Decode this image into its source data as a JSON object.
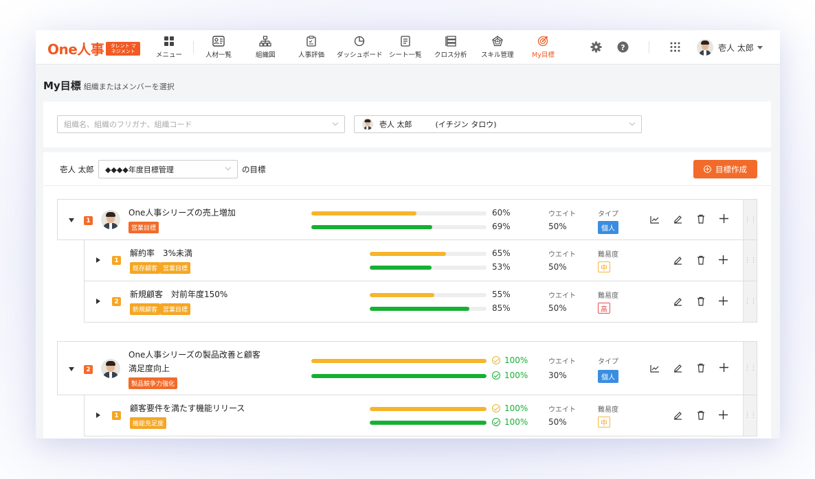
{
  "header": {
    "logo": "One人事",
    "logo_badge": "タレント マネジメント",
    "nav": [
      {
        "label": "メニュー",
        "icon": "grid-menu-icon"
      },
      {
        "label": "人材一覧",
        "icon": "person-card-icon"
      },
      {
        "label": "組織図",
        "icon": "org-chart-icon"
      },
      {
        "label": "人事評価",
        "icon": "clipboard-icon"
      },
      {
        "label": "ダッシュボード",
        "icon": "pie-chart-icon"
      },
      {
        "label": "シート一覧",
        "icon": "sheet-icon"
      },
      {
        "label": "クロス分析",
        "icon": "cross-analysis-icon"
      },
      {
        "label": "スキル管理",
        "icon": "radar-chart-icon"
      },
      {
        "label": "My目標",
        "icon": "target-icon"
      }
    ],
    "user_name": "壱人 太郎",
    "accent": "#f15a22"
  },
  "page": {
    "title": "My目標",
    "subtitle": "組織またはメンバーを選択",
    "org_placeholder": "組織名、組織のフリガナ、組織コード",
    "member_name": "壱人 太郎",
    "member_kana": "(イチジン タロウ)",
    "owner": "壱人 太郎",
    "period": "◆◆◆◆年度目標管理",
    "goals_suffix": "の目標",
    "create_label": "目標作成"
  },
  "labels": {
    "weight": "ウエイト",
    "type": "タイプ",
    "difficulty": "難易度"
  },
  "goals": [
    {
      "num": "1",
      "name": "One人事シリーズの売上増加",
      "tags": [
        "営業目標"
      ],
      "bar1": 60,
      "bar1_label": "60%",
      "bar2": 69,
      "bar2_label": "69%",
      "weight": "50%",
      "type": "個人",
      "children": [
        {
          "num": "1",
          "name": "解約率　3%未満",
          "tags": [
            "既存顧客",
            "営業目標"
          ],
          "bar1": 65,
          "bar1_label": "65%",
          "bar2": 53,
          "bar2_label": "53%",
          "weight": "50%",
          "difficulty": "中"
        },
        {
          "num": "2",
          "name": "新規顧客　対前年度150%",
          "tags": [
            "新規顧客",
            "営業目標"
          ],
          "bar1": 55,
          "bar1_label": "55%",
          "bar2": 85,
          "bar2_label": "85%",
          "weight": "50%",
          "difficulty": "高"
        }
      ]
    },
    {
      "num": "2",
      "name_line1": "One人事シリーズの製品改善と顧客",
      "name_line2": "満足度向上",
      "tags": [
        "製品競争力強化"
      ],
      "bar1": 100,
      "bar1_label": "100%",
      "bar2": 100,
      "bar2_label": "100%",
      "weight": "30%",
      "type": "個人",
      "children": [
        {
          "num": "1",
          "name": "顧客要件を満たす機能リリース",
          "tags": [
            "機能充足度"
          ],
          "bar1": 100,
          "bar1_label": "100%",
          "bar2": 100,
          "bar2_label": "100%",
          "weight": "50%",
          "difficulty": "中"
        }
      ]
    }
  ]
}
